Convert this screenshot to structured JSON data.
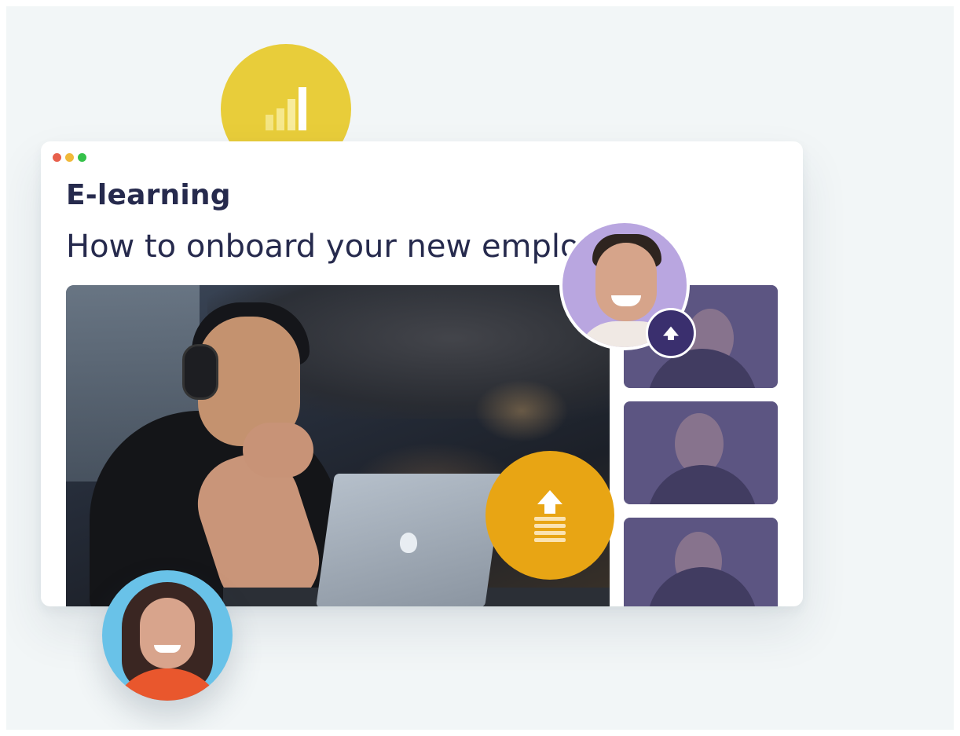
{
  "window": {
    "title": "E-learning",
    "subtitle": "How to onboard your new emplo"
  },
  "icons": {
    "chart": "bar-chart-icon",
    "upload_small": "upload-arrow-icon",
    "upload_big": "upload-stack-icon"
  },
  "colors": {
    "accent_yellow": "#e8cd3a",
    "accent_orange": "#e8a514",
    "accent_purple": "#3a2f6e",
    "title_navy": "#262a4d",
    "traffic_red": "#e8604c",
    "traffic_yellow": "#f0b93a",
    "traffic_green": "#35c14a"
  }
}
